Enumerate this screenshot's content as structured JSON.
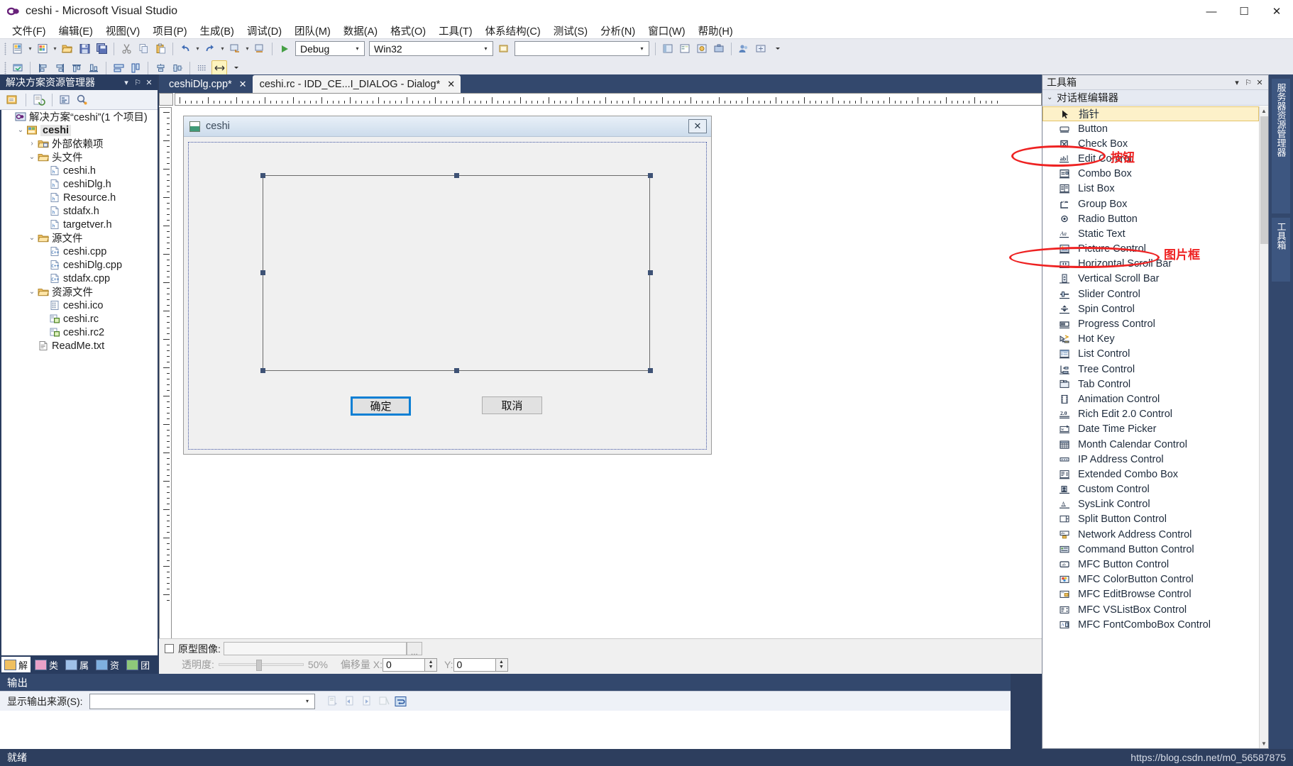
{
  "window": {
    "title": "ceshi - Microsoft Visual Studio",
    "logo_icon": "visual-studio-logo",
    "minimize": "—",
    "maximize": "☐",
    "close": "✕"
  },
  "menubar": {
    "items": [
      {
        "label": "文件(F)"
      },
      {
        "label": "编辑(E)"
      },
      {
        "label": "视图(V)"
      },
      {
        "label": "项目(P)"
      },
      {
        "label": "生成(B)"
      },
      {
        "label": "调试(D)"
      },
      {
        "label": "团队(M)"
      },
      {
        "label": "数据(A)"
      },
      {
        "label": "格式(O)"
      },
      {
        "label": "工具(T)"
      },
      {
        "label": "体系结构(C)"
      },
      {
        "label": "测试(S)"
      },
      {
        "label": "分析(N)"
      },
      {
        "label": "窗口(W)"
      },
      {
        "label": "帮助(H)"
      }
    ]
  },
  "toolbar": {
    "config_value": "Debug",
    "platform_value": "Win32",
    "find_value": "",
    "arrow": "▾"
  },
  "solution_explorer": {
    "title": "解决方案资源管理器",
    "dropdown_icon": "▾",
    "pin_icon": "⚐",
    "close_icon": "✕",
    "tree": [
      {
        "indent": 0,
        "arrow": "",
        "icon": "solution-icon",
        "label": "解决方案“ceshi”(1 个项目)",
        "selected": false
      },
      {
        "indent": 1,
        "arrow": "⌄",
        "icon": "project-icon",
        "label": "ceshi",
        "selected": true
      },
      {
        "indent": 2,
        "arrow": "›",
        "icon": "folder-ref-icon",
        "label": "外部依赖项",
        "selected": false
      },
      {
        "indent": 2,
        "arrow": "⌄",
        "icon": "folder-icon",
        "label": "头文件",
        "selected": false
      },
      {
        "indent": 3,
        "arrow": "",
        "icon": "header-file-icon",
        "label": "ceshi.h",
        "selected": false
      },
      {
        "indent": 3,
        "arrow": "",
        "icon": "header-file-icon",
        "label": "ceshiDlg.h",
        "selected": false
      },
      {
        "indent": 3,
        "arrow": "",
        "icon": "header-file-icon",
        "label": "Resource.h",
        "selected": false
      },
      {
        "indent": 3,
        "arrow": "",
        "icon": "header-file-icon",
        "label": "stdafx.h",
        "selected": false
      },
      {
        "indent": 3,
        "arrow": "",
        "icon": "header-file-icon",
        "label": "targetver.h",
        "selected": false
      },
      {
        "indent": 2,
        "arrow": "⌄",
        "icon": "folder-icon",
        "label": "源文件",
        "selected": false
      },
      {
        "indent": 3,
        "arrow": "",
        "icon": "cpp-file-icon",
        "label": "ceshi.cpp",
        "selected": false
      },
      {
        "indent": 3,
        "arrow": "",
        "icon": "cpp-file-icon",
        "label": "ceshiDlg.cpp",
        "selected": false
      },
      {
        "indent": 3,
        "arrow": "",
        "icon": "cpp-file-icon",
        "label": "stdafx.cpp",
        "selected": false
      },
      {
        "indent": 2,
        "arrow": "⌄",
        "icon": "folder-icon",
        "label": "资源文件",
        "selected": false
      },
      {
        "indent": 3,
        "arrow": "",
        "icon": "ico-file-icon",
        "label": "ceshi.ico",
        "selected": false
      },
      {
        "indent": 3,
        "arrow": "",
        "icon": "rc-file-icon",
        "label": "ceshi.rc",
        "selected": false
      },
      {
        "indent": 3,
        "arrow": "",
        "icon": "rc-file-icon",
        "label": "ceshi.rc2",
        "selected": false
      },
      {
        "indent": 2,
        "arrow": "",
        "icon": "txt-file-icon",
        "label": "ReadMe.txt",
        "selected": false
      }
    ],
    "bottom_tabs": [
      {
        "label": "解",
        "icon": "solution-explorer-icon",
        "active": true
      },
      {
        "label": "类",
        "icon": "class-view-icon",
        "active": false
      },
      {
        "label": "属",
        "icon": "properties-icon",
        "active": false
      },
      {
        "label": "资",
        "icon": "resource-view-icon",
        "active": false
      },
      {
        "label": "团",
        "icon": "team-explorer-icon",
        "active": false
      }
    ]
  },
  "output": {
    "title": "输出",
    "source_label": "显示输出来源(S):",
    "source_value": "",
    "arrow": "▾"
  },
  "editor": {
    "tabs": [
      {
        "label": "ceshiDlg.cpp*",
        "active": false,
        "close": "✕"
      },
      {
        "label": "ceshi.rc - IDD_CE...I_DIALOG - Dialog*",
        "active": true,
        "close": "✕"
      }
    ]
  },
  "dialog_preview": {
    "caption": "ceshi",
    "caption_icon": "app-icon",
    "close_label": "✕",
    "picture_control": {
      "name": "IDC_PICTURE",
      "selected": true
    },
    "buttons": [
      {
        "label": "确定",
        "focused": true
      },
      {
        "label": "取消",
        "focused": false
      }
    ]
  },
  "prototype_bar": {
    "checkbox_label": "原型图像:",
    "checked": false,
    "path_value": "",
    "browse_label": "...",
    "transparency_label": "透明度:",
    "transparency_value": "50%",
    "offset_label": "偏移量 X:",
    "offset_x": "0",
    "offset_y_label": "Y:",
    "offset_y": "0"
  },
  "toolbox": {
    "title": "工具箱",
    "dropdown_icon": "▾",
    "pin_icon": "⚐",
    "close_icon": "✕",
    "category": "对话框编辑器",
    "category_chevron": "⌄",
    "items": [
      {
        "label": "指针",
        "icon": "pointer-icon",
        "selected": true
      },
      {
        "label": "Button",
        "icon": "button-icon",
        "selected": false
      },
      {
        "label": "Check Box",
        "icon": "checkbox-icon",
        "selected": false
      },
      {
        "label": "Edit Control",
        "icon": "edit-control-icon",
        "selected": false
      },
      {
        "label": "Combo Box",
        "icon": "combo-box-icon",
        "selected": false
      },
      {
        "label": "List Box",
        "icon": "list-box-icon",
        "selected": false
      },
      {
        "label": "Group Box",
        "icon": "group-box-icon",
        "selected": false
      },
      {
        "label": "Radio Button",
        "icon": "radio-button-icon",
        "selected": false
      },
      {
        "label": "Static Text",
        "icon": "static-text-icon",
        "selected": false
      },
      {
        "label": "Picture Control",
        "icon": "picture-control-icon",
        "selected": false
      },
      {
        "label": "Horizontal Scroll Bar",
        "icon": "hscrollbar-icon",
        "selected": false
      },
      {
        "label": "Vertical Scroll Bar",
        "icon": "vscrollbar-icon",
        "selected": false
      },
      {
        "label": "Slider Control",
        "icon": "slider-icon",
        "selected": false
      },
      {
        "label": "Spin Control",
        "icon": "spin-icon",
        "selected": false
      },
      {
        "label": "Progress Control",
        "icon": "progress-icon",
        "selected": false
      },
      {
        "label": "Hot Key",
        "icon": "hotkey-icon",
        "selected": false
      },
      {
        "label": "List Control",
        "icon": "list-control-icon",
        "selected": false
      },
      {
        "label": "Tree Control",
        "icon": "tree-control-icon",
        "selected": false
      },
      {
        "label": "Tab Control",
        "icon": "tab-control-icon",
        "selected": false
      },
      {
        "label": "Animation Control",
        "icon": "animation-icon",
        "selected": false
      },
      {
        "label": "Rich Edit 2.0 Control",
        "icon": "rich-edit-icon",
        "selected": false
      },
      {
        "label": "Date Time Picker",
        "icon": "datetime-picker-icon",
        "selected": false
      },
      {
        "label": "Month Calendar Control",
        "icon": "calendar-icon",
        "selected": false
      },
      {
        "label": "IP Address Control",
        "icon": "ip-address-icon",
        "selected": false
      },
      {
        "label": "Extended Combo Box",
        "icon": "extended-combo-icon",
        "selected": false
      },
      {
        "label": "Custom Control",
        "icon": "custom-control-icon",
        "selected": false
      },
      {
        "label": "SysLink Control",
        "icon": "syslink-icon",
        "selected": false
      },
      {
        "label": "Split Button Control",
        "icon": "split-button-icon",
        "selected": false
      },
      {
        "label": "Network Address Control",
        "icon": "network-address-icon",
        "selected": false
      },
      {
        "label": "Command Button Control",
        "icon": "command-button-icon",
        "selected": false
      },
      {
        "label": "MFC Button Control",
        "icon": "mfc-button-icon",
        "selected": false
      },
      {
        "label": "MFC ColorButton Control",
        "icon": "mfc-colorbutton-icon",
        "selected": false
      },
      {
        "label": "MFC EditBrowse Control",
        "icon": "mfc-editbrowse-icon",
        "selected": false
      },
      {
        "label": "MFC VSListBox Control",
        "icon": "mfc-vslistbox-icon",
        "selected": false
      },
      {
        "label": "MFC FontComboBox Control",
        "icon": "mfc-fontcombo-icon",
        "selected": false
      }
    ]
  },
  "annotations": [
    {
      "text": "按钮",
      "color": "#ee2222"
    },
    {
      "text": "图片框",
      "color": "#ee2222"
    }
  ],
  "right_rail": {
    "tabs": [
      {
        "label": "服务器资源管理器"
      },
      {
        "label": "工具箱"
      }
    ]
  },
  "statusbar": {
    "status": "就绪",
    "watermark": "https://blog.csdn.net/m0_56587875"
  }
}
